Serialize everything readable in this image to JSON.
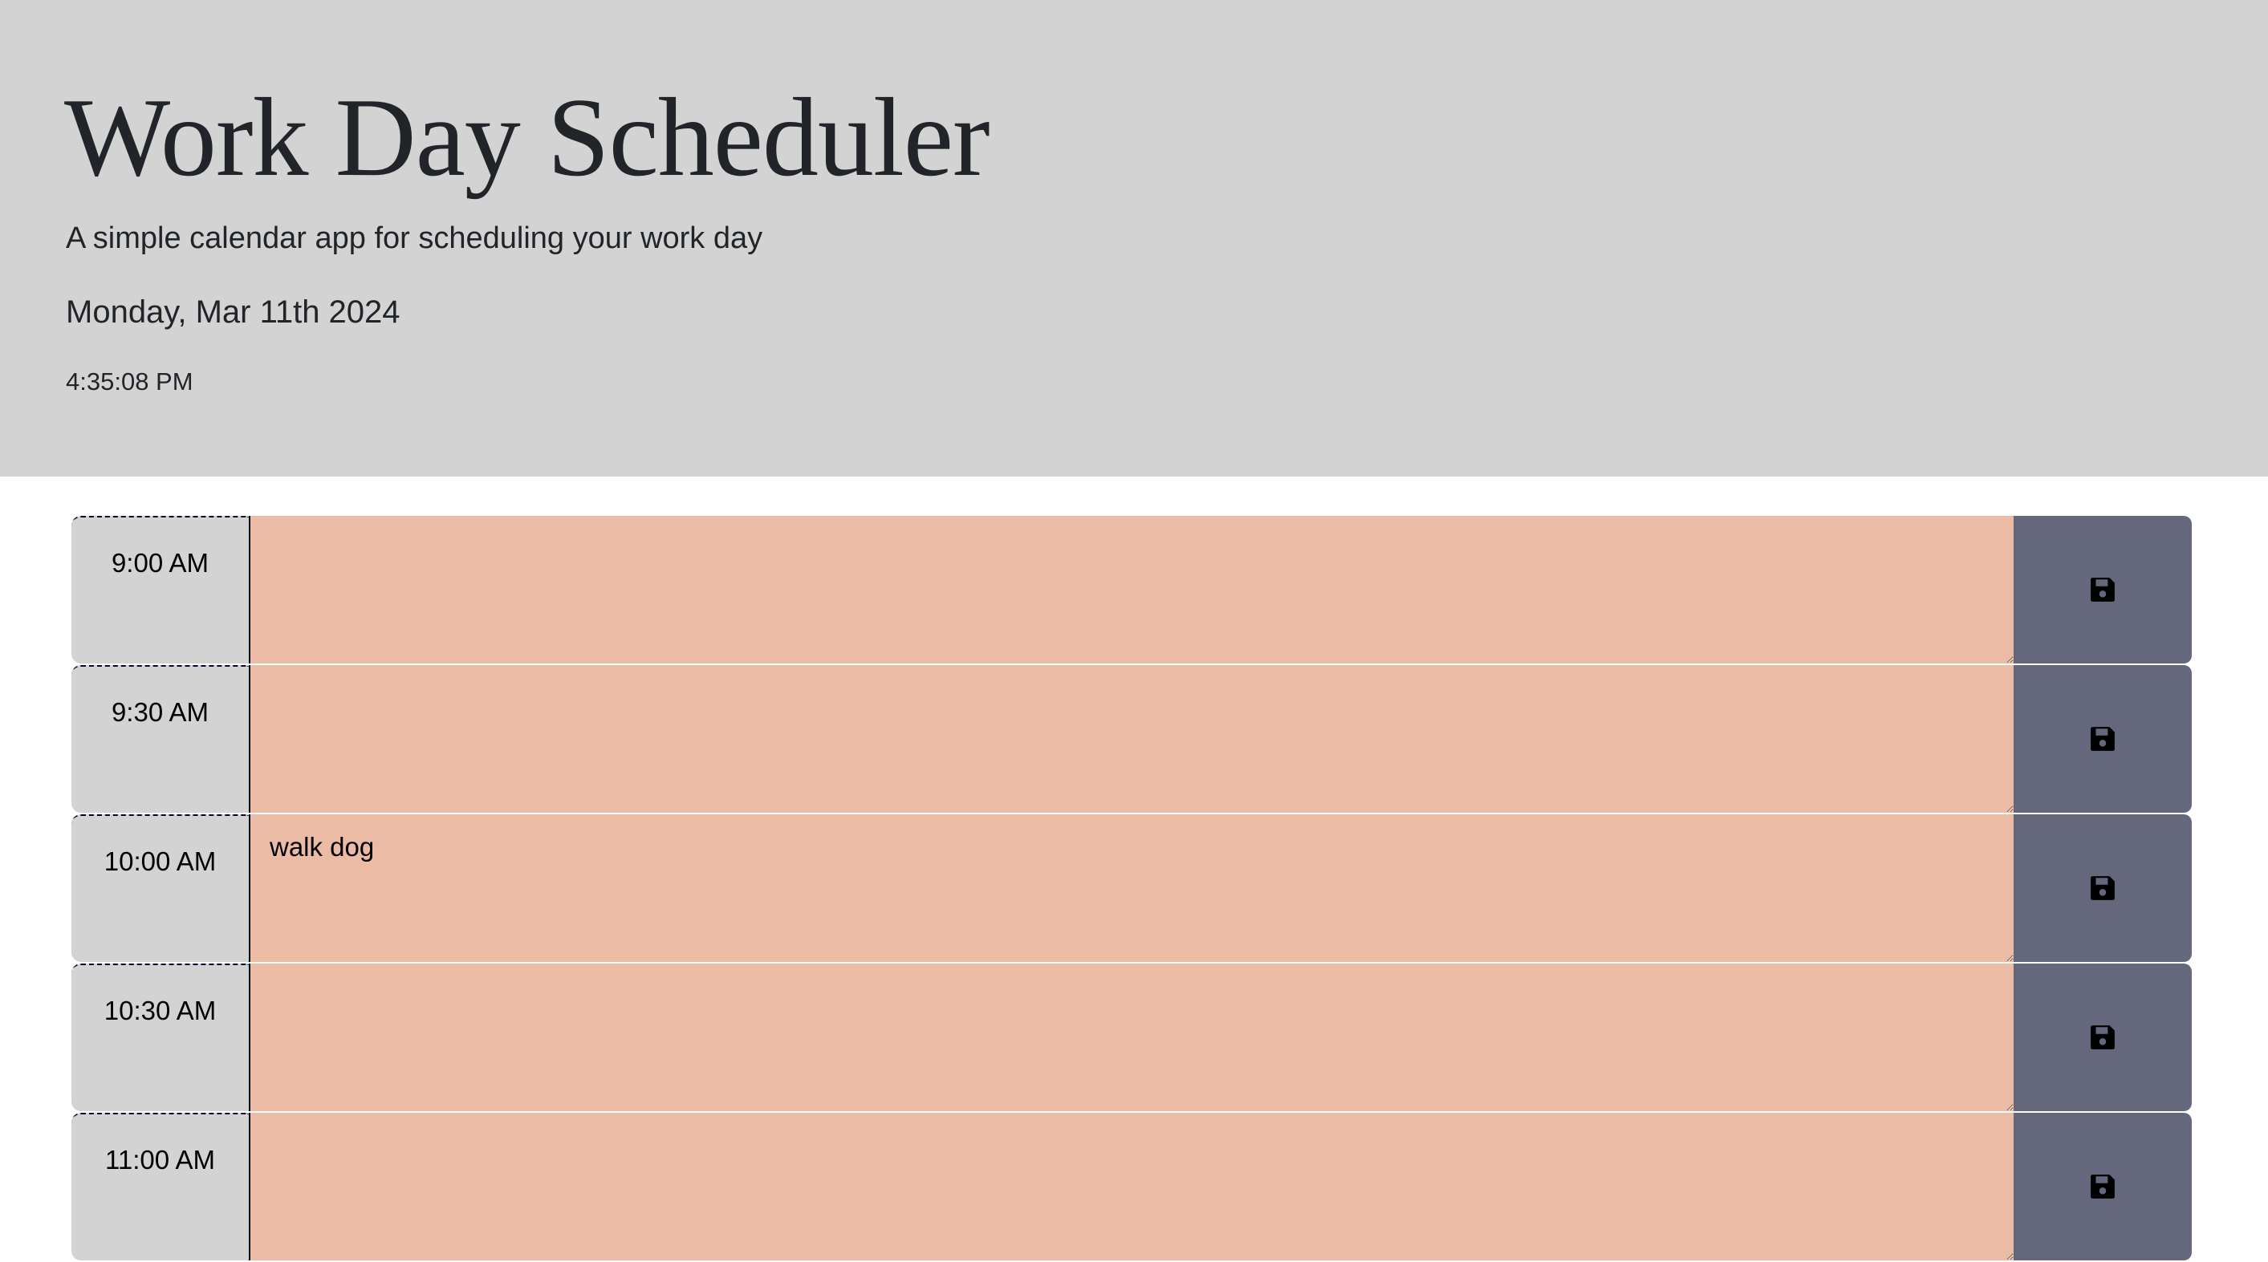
{
  "header": {
    "title": "Work Day Scheduler",
    "subtitle": "A simple calendar app for scheduling your work day",
    "date": "Monday, Mar 11th 2024",
    "time": "4:35:08 PM"
  },
  "colors": {
    "header_bg": "#d3d3d3",
    "past_bg": "#ebbba6",
    "save_bg": "#65687d"
  },
  "rows": [
    {
      "hour": "9:00 AM",
      "text": "",
      "save_icon": "floppy-disk-icon"
    },
    {
      "hour": "9:30 AM",
      "text": "",
      "save_icon": "floppy-disk-icon"
    },
    {
      "hour": "10:00 AM",
      "text": "walk dog",
      "save_icon": "floppy-disk-icon"
    },
    {
      "hour": "10:30 AM",
      "text": "",
      "save_icon": "floppy-disk-icon"
    },
    {
      "hour": "11:00 AM",
      "text": "",
      "save_icon": "floppy-disk-icon"
    }
  ]
}
